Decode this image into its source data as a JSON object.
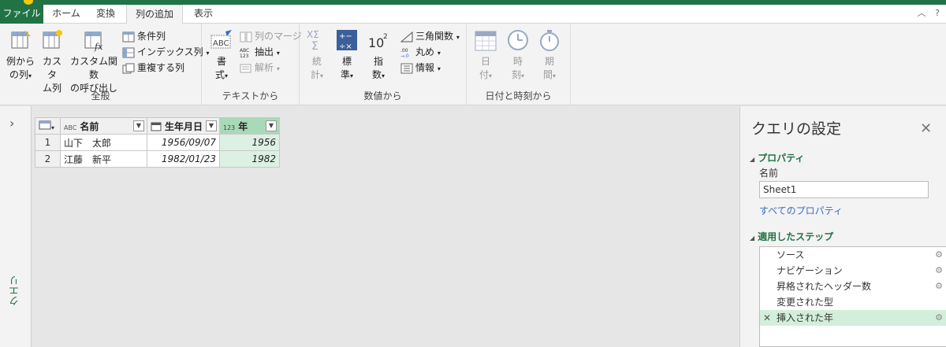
{
  "tabs": {
    "file": "ファイル",
    "home": "ホーム",
    "transform": "変換",
    "add_column": "列の追加",
    "view": "表示"
  },
  "ribbon": {
    "general": {
      "label": "全般",
      "col_from_examples": [
        "例から",
        "の列"
      ],
      "custom_column": [
        "カスタ",
        "ム列"
      ],
      "custom_function": [
        "カスタム関数",
        "の呼び出し"
      ],
      "conditional_column": "条件列",
      "index_column": "インデックス列",
      "duplicate_column": "重複する列"
    },
    "text": {
      "label": "テキストから",
      "format": [
        "書",
        "式"
      ],
      "merge_columns": "列のマージ",
      "extract": "抽出",
      "parse": "解析"
    },
    "number": {
      "label": "数値から",
      "statistics": [
        "統",
        "計"
      ],
      "standard": [
        "標",
        "準"
      ],
      "scientific": [
        "指",
        "数"
      ],
      "trigonometry": "三角関数",
      "rounding": "丸め",
      "information": "情報"
    },
    "datetime": {
      "label": "日付と時刻から",
      "date": [
        "日",
        "付"
      ],
      "time": [
        "時",
        "刻"
      ],
      "duration": [
        "期",
        "間"
      ]
    }
  },
  "left_pane": {
    "label": "クエリ"
  },
  "grid": {
    "columns": [
      {
        "type_icon": "ABC",
        "name": "名前"
      },
      {
        "type_icon": "cal",
        "name": "生年月日"
      },
      {
        "type_icon": "123",
        "name": "年"
      }
    ],
    "rows": [
      {
        "num": "1",
        "name": "山下　太郎",
        "dob": "1956/09/07",
        "year": "1956"
      },
      {
        "num": "2",
        "name": "江藤　新平",
        "dob": "1982/01/23",
        "year": "1982"
      }
    ]
  },
  "query_settings": {
    "title": "クエリの設定",
    "properties_header": "プロパティ",
    "name_label": "名前",
    "name_value": "Sheet1",
    "all_properties_link": "すべてのプロパティ",
    "applied_steps_header": "適用したステップ",
    "steps": [
      "ソース",
      "ナビゲーション",
      "昇格されたヘッダー数",
      "変更された型",
      "挿入された年"
    ]
  }
}
